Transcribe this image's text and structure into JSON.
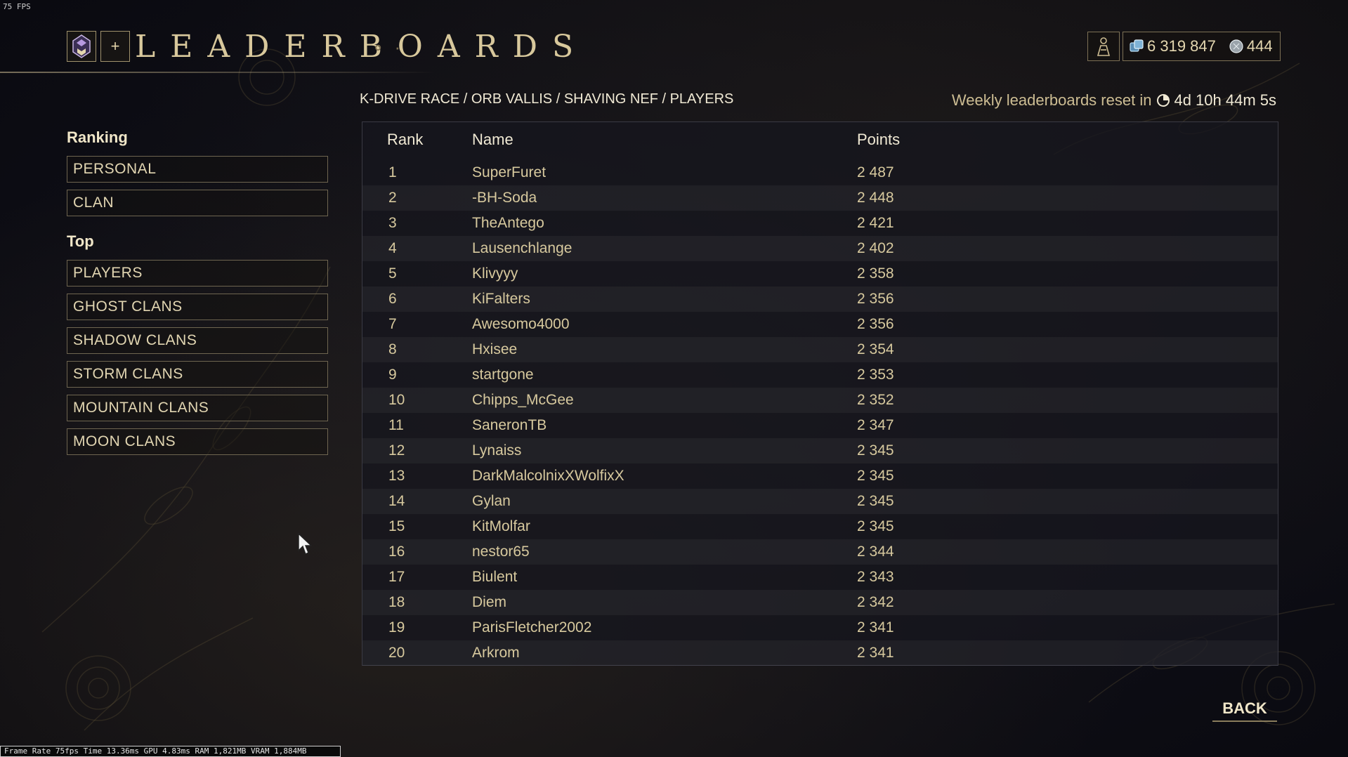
{
  "overlay": {
    "fps": "75 FPS",
    "perf_stats": "Frame Rate 75fps Time 13.36ms GPU 4.83ms RAM 1,821MB VRAM 1,884MB"
  },
  "header": {
    "title": "LEADERBOARDS",
    "plus_label": "+",
    "currency": {
      "credits": "6 319 847",
      "platinum": "444"
    }
  },
  "nav": {
    "ranking_heading": "Ranking",
    "ranking_items": [
      "PERSONAL",
      "CLAN"
    ],
    "top_heading": "Top",
    "top_items": [
      "PLAYERS",
      "GHOST CLANS",
      "SHADOW CLANS",
      "STORM CLANS",
      "MOUNTAIN CLANS",
      "MOON CLANS"
    ]
  },
  "breadcrumb": "K-DRIVE RACE / ORB VALLIS / SHAVING NEF / PLAYERS",
  "reset": {
    "label": "Weekly leaderboards reset in",
    "timer": "4d 10h 44m 5s"
  },
  "table": {
    "columns": {
      "rank": "Rank",
      "name": "Name",
      "points": "Points"
    },
    "rows": [
      {
        "rank": "1",
        "name": "SuperFuret",
        "points": "2 487"
      },
      {
        "rank": "2",
        "name": "-BH-Soda",
        "points": "2 448"
      },
      {
        "rank": "3",
        "name": "TheAntego",
        "points": "2 421"
      },
      {
        "rank": "4",
        "name": "Lausenchlange",
        "points": "2 402"
      },
      {
        "rank": "5",
        "name": "Klivyyy",
        "points": "2 358"
      },
      {
        "rank": "6",
        "name": "KiFalters",
        "points": "2 356"
      },
      {
        "rank": "7",
        "name": "Awesomo4000",
        "points": "2 356"
      },
      {
        "rank": "8",
        "name": "Hxisee",
        "points": "2 354"
      },
      {
        "rank": "9",
        "name": "startgone",
        "points": "2 353"
      },
      {
        "rank": "10",
        "name": "Chipps_McGee",
        "points": "2 352"
      },
      {
        "rank": "11",
        "name": "SaneronTB",
        "points": "2 347"
      },
      {
        "rank": "12",
        "name": "Lynaiss",
        "points": "2 345"
      },
      {
        "rank": "13",
        "name": "DarkMalcolnixXWolfixX",
        "points": "2 345"
      },
      {
        "rank": "14",
        "name": "Gylan",
        "points": "2 345"
      },
      {
        "rank": "15",
        "name": "KitMolfar",
        "points": "2 345"
      },
      {
        "rank": "16",
        "name": "nestor65",
        "points": "2 344"
      },
      {
        "rank": "17",
        "name": "Biulent",
        "points": "2 343"
      },
      {
        "rank": "18",
        "name": "Diem",
        "points": "2 342"
      },
      {
        "rank": "19",
        "name": "ParisFletcher2002",
        "points": "2 341"
      },
      {
        "rank": "20",
        "name": "Arkrom",
        "points": "2 341"
      }
    ]
  },
  "back_label": "BACK",
  "colors": {
    "accent_gold": "#cdbd93",
    "text_light": "#f0e9d4",
    "panel_bg": "#16161e"
  },
  "icons": {
    "logo": "clan-sigil-icon",
    "mastery": "mastery-rank-icon",
    "credits": "credits-icon",
    "platinum": "platinum-icon",
    "clock": "clock-icon"
  }
}
